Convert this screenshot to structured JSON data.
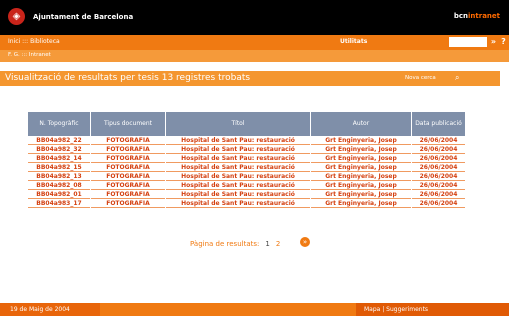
{
  "header": {
    "logo_glyph": "◈",
    "org_name": "Ajuntament de Barcelona",
    "brand_main": "bcn",
    "brand_accent": "intranet"
  },
  "nav": {
    "breadcrumb": "Inici  ::: Biblioteca",
    "utilities_label": "Utilitats",
    "search_placeholder": "",
    "go_glyph": "»",
    "help_glyph": "?"
  },
  "subnav": {
    "path": "F. G. ::: Intranet"
  },
  "results": {
    "title": "Visualització de resultats per tesis 13 registres trobats",
    "new_search_label": "Nova cerca",
    "new_search_icon": "search-icon"
  },
  "table": {
    "columns": [
      "N. Topogràfic",
      "Tipus document",
      "Títol",
      "Autor",
      "Data publicació"
    ],
    "rows": [
      [
        "BB04a982_22",
        "FOTOGRAFIA",
        "Hospital de Sant Pau: restauració",
        "Grt Enginyeria, Josep",
        "26/06/2004"
      ],
      [
        "BB04a982_32",
        "FOTOGRAFIA",
        "Hospital de Sant Pau: restauració",
        "Grt Enginyeria, Josep",
        "26/06/2004"
      ],
      [
        "BB04a982_14",
        "FOTOGRAFIA",
        "Hospital de Sant Pau: restauració",
        "Grt Enginyeria, Josep",
        "26/06/2004"
      ],
      [
        "BB04a982_15",
        "FOTOGRAFIA",
        "Hospital de Sant Pau: restauració",
        "Grt Enginyeria, Josep",
        "26/06/2004"
      ],
      [
        "BB04a982_13",
        "FOTOGRAFIA",
        "Hospital de Sant Pau: restauració",
        "Grt Enginyeria, Josep",
        "26/06/2004"
      ],
      [
        "BB04a982_08",
        "FOTOGRAFIA",
        "Hospital de Sant Pau: restauració",
        "Grt Enginyeria, Josep",
        "26/06/2004"
      ],
      [
        "BB04a982_01",
        "FOTOGRAFIA",
        "Hospital de Sant Pau: restauració",
        "Grt Enginyeria, Josep",
        "26/06/2004"
      ],
      [
        "BB04a983_17",
        "FOTOGRAFIA",
        "Hospital de Sant Pau: restauració",
        "Grt Enginyeria, Josep",
        "26/06/2004"
      ]
    ]
  },
  "pager": {
    "label": "Pàgina de resultats:",
    "pages": [
      "1",
      "2"
    ],
    "current": "1",
    "next_glyph": "»"
  },
  "footer": {
    "date": "19 de Maig de 2004",
    "links": "Mapa  |  Suggeriments"
  },
  "colors": {
    "accent": "#f07a12",
    "table_header": "#7f8fa9",
    "cell_text": "#d44010"
  }
}
